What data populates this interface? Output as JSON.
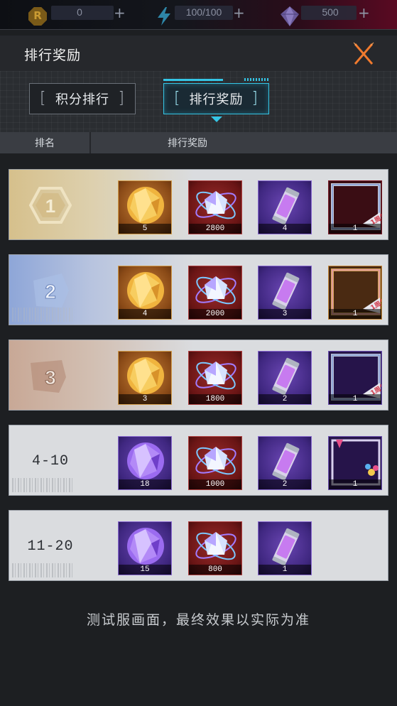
{
  "resources": [
    {
      "icon": "r-coin-icon",
      "value": "0"
    },
    {
      "icon": "energy-bolt-icon",
      "value": "100/100"
    },
    {
      "icon": "crystal-gem-icon",
      "value": "500"
    }
  ],
  "header": {
    "title": "排行奖励"
  },
  "tabs": [
    {
      "label": "积分排行",
      "active": false
    },
    {
      "label": "排行奖励",
      "active": true
    }
  ],
  "columns": {
    "rank": "排名",
    "reward": "排行奖励"
  },
  "rows": [
    {
      "rank": "1",
      "rewards": [
        {
          "icon": "gold-crystal-icon",
          "count": "5"
        },
        {
          "icon": "prism-core-icon",
          "count": "2800"
        },
        {
          "icon": "energy-canister-icon",
          "count": "4"
        },
        {
          "icon": "anniversary-frame-icon",
          "count": "1"
        }
      ]
    },
    {
      "rank": "2",
      "rewards": [
        {
          "icon": "gold-crystal-icon",
          "count": "4"
        },
        {
          "icon": "prism-core-icon",
          "count": "2000"
        },
        {
          "icon": "energy-canister-icon",
          "count": "3"
        },
        {
          "icon": "anniversary-frame-icon",
          "count": "1"
        }
      ]
    },
    {
      "rank": "3",
      "rewards": [
        {
          "icon": "gold-crystal-icon",
          "count": "3"
        },
        {
          "icon": "prism-core-icon",
          "count": "1800"
        },
        {
          "icon": "energy-canister-icon",
          "count": "2"
        },
        {
          "icon": "anniversary-frame-icon",
          "count": "1"
        }
      ]
    },
    {
      "rank": "4-10",
      "rewards": [
        {
          "icon": "purple-crystal-icon",
          "count": "18"
        },
        {
          "icon": "prism-core-icon",
          "count": "1000"
        },
        {
          "icon": "energy-canister-icon",
          "count": "2"
        },
        {
          "icon": "party-frame-icon",
          "count": "1"
        }
      ]
    },
    {
      "rank": "11-20",
      "rewards": [
        {
          "icon": "purple-crystal-icon",
          "count": "15"
        },
        {
          "icon": "prism-core-icon",
          "count": "800"
        },
        {
          "icon": "energy-canister-icon",
          "count": "1"
        }
      ]
    }
  ],
  "footer_note": "测试服画面，最终效果以实际为准",
  "colors": {
    "accent": "#35c6e6",
    "close": "#f07a2e",
    "gold_badge": "#d9c08a",
    "silver_badge": "#9fb4e0",
    "bronze_badge": "#c9a58e"
  }
}
